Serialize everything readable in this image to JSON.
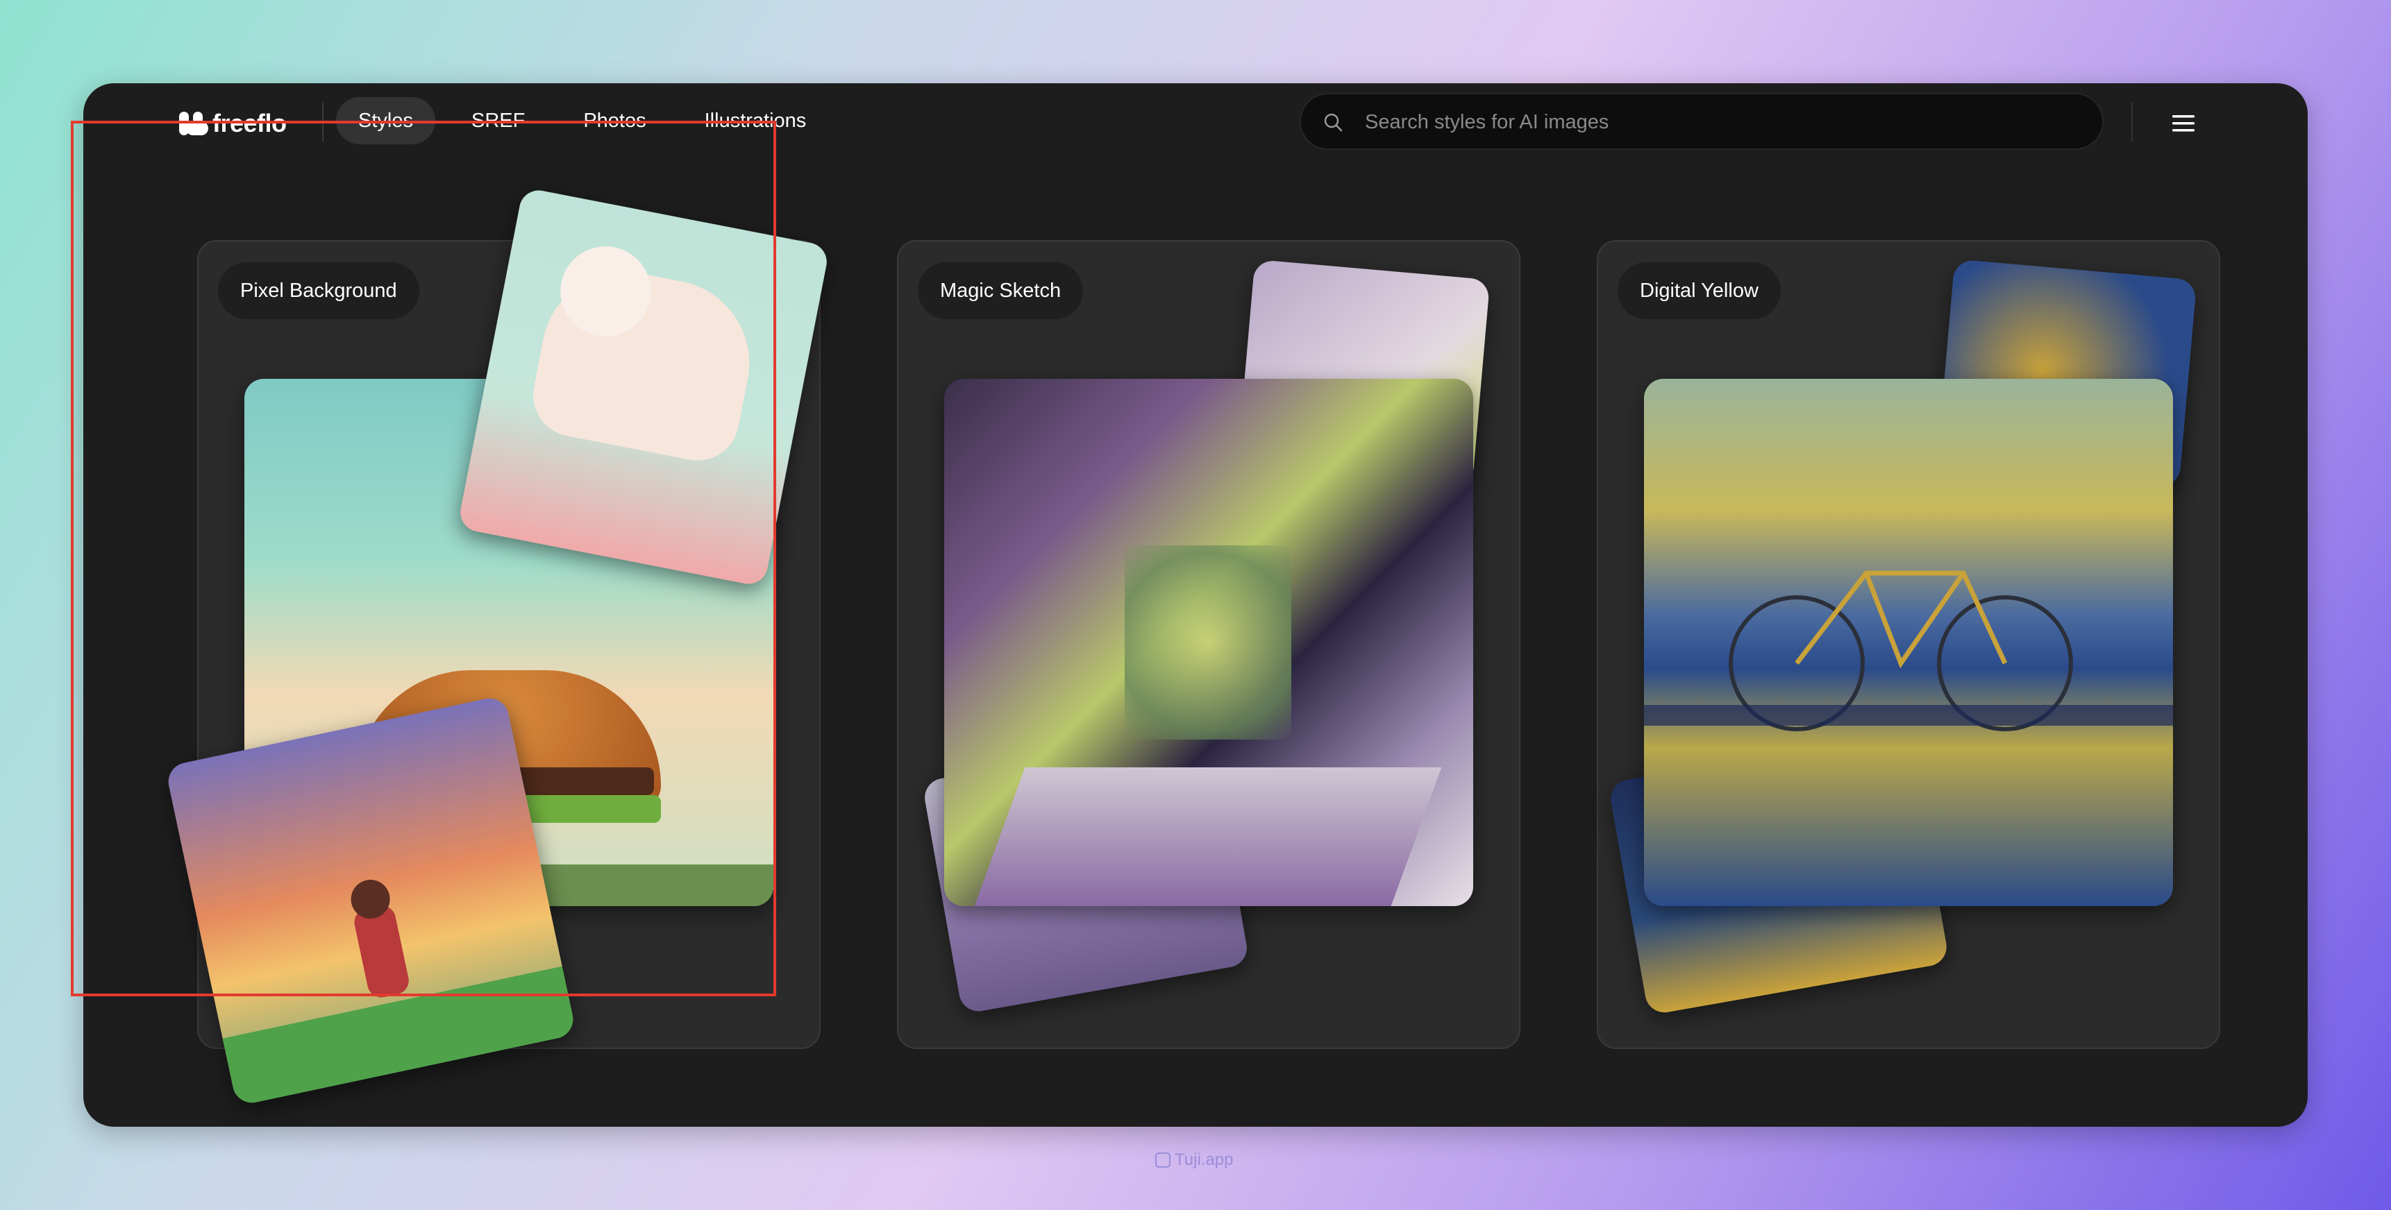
{
  "app": {
    "brand": "freeflo"
  },
  "nav": {
    "tabs": [
      {
        "label": "Styles",
        "active": true
      },
      {
        "label": "SREF",
        "active": false
      },
      {
        "label": "Photos",
        "active": false
      },
      {
        "label": "Illustrations",
        "active": false
      }
    ],
    "search_placeholder": "Search styles for AI images",
    "search_icon": "search-icon",
    "menu_icon": "hamburger-menu-icon"
  },
  "cards": [
    {
      "label": "Pixel Background",
      "highlighted": true
    },
    {
      "label": "Magic Sketch",
      "highlighted": false
    },
    {
      "label": "Digital Yellow",
      "highlighted": false
    }
  ],
  "colors": {
    "highlight": "#e23b2e",
    "panel": "#1d1d1d",
    "card": "#2b2b2b"
  },
  "watermark": "Tuji.app"
}
